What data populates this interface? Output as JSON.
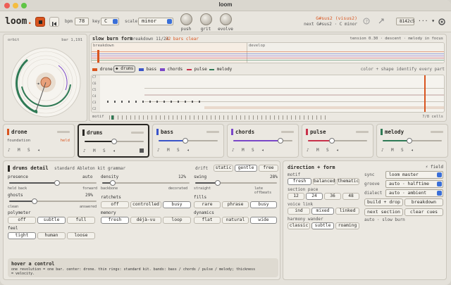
{
  "window": {
    "title": "loom"
  },
  "topbar": {
    "logo": "loom",
    "stop_icon": "stop-icon",
    "rewind_icon": "skip-back-icon",
    "bpm_label": "bpm",
    "bpm_value": "78",
    "key_label": "key",
    "key_value": "C",
    "scale_label": "scale",
    "scale_value": "minor",
    "knobs": [
      "push",
      "grit",
      "evolve"
    ],
    "chord": "G#sus2 (visus2)",
    "next": "next G#sus2 · C minor",
    "hash": "8142c5",
    "more": "···"
  },
  "form": {
    "title": "slow burn form",
    "breakdown": "breakdown 11/24",
    "bars_clear": "32 bars clear",
    "tension": "tension 0.30 · descent · melody in focus",
    "sections": [
      "breakdown",
      "develop"
    ]
  },
  "orbit": {
    "label": "orbit",
    "bar": "bar 1,191"
  },
  "legend": {
    "items": [
      "drone",
      "drums",
      "bass",
      "chords",
      "pulse",
      "melody"
    ],
    "note": "color + shape identify every part"
  },
  "pianoroll": {
    "notes": [
      "C7",
      "C6",
      "C5",
      "C4",
      "C3",
      "C2"
    ],
    "motif_label": "motif",
    "cells": "7/8 cells"
  },
  "tracks": [
    {
      "name": "drone",
      "sub": "foundation",
      "status": "held",
      "color": "#d9541e",
      "level": 0.0
    },
    {
      "name": "drums",
      "color": "#2a2824",
      "level": 0.5
    },
    {
      "name": "bass",
      "color": "#3b55c9",
      "level": 0.45
    },
    {
      "name": "chords",
      "color": "#7a47c8",
      "level": 0.8
    },
    {
      "name": "pulse",
      "color": "#c8324b",
      "level": 0.4
    },
    {
      "name": "melody",
      "color": "#2f7a55",
      "level": 0.45
    }
  ],
  "track_controls": {
    "m": "M",
    "s": "S"
  },
  "drums": {
    "title": "drums detail",
    "sub": "standard Ableton kit grammar",
    "drift_label": "drift",
    "drift_opts": [
      "static",
      "gentle",
      "free"
    ],
    "drift_sel": "gentle",
    "presence": {
      "label": "presence",
      "value": "auto",
      "lo": "held back",
      "hi": "forward",
      "level": 0.55
    },
    "density": {
      "label": "density",
      "value": "12%",
      "lo": "backbone",
      "hi": "decorated",
      "level": 0.12
    },
    "swing": {
      "label": "swing",
      "value": "28%",
      "lo": "straight",
      "hi": "late offbeats",
      "level": 0.28
    },
    "ghosts": {
      "label": "ghosts",
      "value": "29%",
      "lo": "clean",
      "hi": "answered",
      "level": 0.29
    },
    "ratchets": {
      "label": "ratchets",
      "opts": [
        "off",
        "controlled",
        "busy"
      ],
      "sel": "busy"
    },
    "fills": {
      "label": "fills",
      "opts": [
        "rare",
        "phrase",
        "busy"
      ],
      "sel": "busy"
    },
    "polymeter": {
      "label": "polymeter",
      "opts": [
        "off",
        "subtle",
        "full"
      ],
      "sel": "subtle"
    },
    "memory": {
      "label": "memory",
      "opts": [
        "fresh",
        "déjà-vu",
        "loop"
      ],
      "sel": "fresh"
    },
    "dynamics": {
      "label": "dynamics",
      "opts": [
        "flat",
        "natural",
        "wide"
      ],
      "sel": "wide"
    },
    "feel": {
      "label": "feel",
      "opts": [
        "tight",
        "human",
        "loose"
      ],
      "sel": "tight"
    }
  },
  "hover": {
    "title": "hover a control",
    "text1": "one revolution = one bar. center: drone. thin rings: standard kit. bands: bass / chords / pulse / melody; thickness",
    "text2": "= velocity."
  },
  "direction": {
    "title": "direction + form",
    "field": "field",
    "motif_label": "motif",
    "motif_opts": [
      "fresh",
      "balanced",
      "thematic"
    ],
    "motif_sel": "fresh",
    "pace_label": "section pace",
    "pace_opts": [
      "12",
      "24",
      "36",
      "48"
    ],
    "pace_sel": "24",
    "voice_label": "voice link",
    "voice_opts": [
      "ind",
      "mixed",
      "linked"
    ],
    "voice_sel": "mixed",
    "harm_label": "harmony wander",
    "harm_opts": [
      "classic",
      "subtle",
      "roaming"
    ],
    "harm_sel": "subtle",
    "sync_label": "sync",
    "sync_value": "loom master",
    "groove_label": "groove",
    "groove_value": "auto · halftime",
    "dialect_label": "dialect",
    "dialect_value": "auto · ambient",
    "build_drop": "build + drop",
    "breakdown": "breakdown",
    "next_section": "next section",
    "clear_cues": "clear cues",
    "auto_note": "auto · slow burn"
  }
}
